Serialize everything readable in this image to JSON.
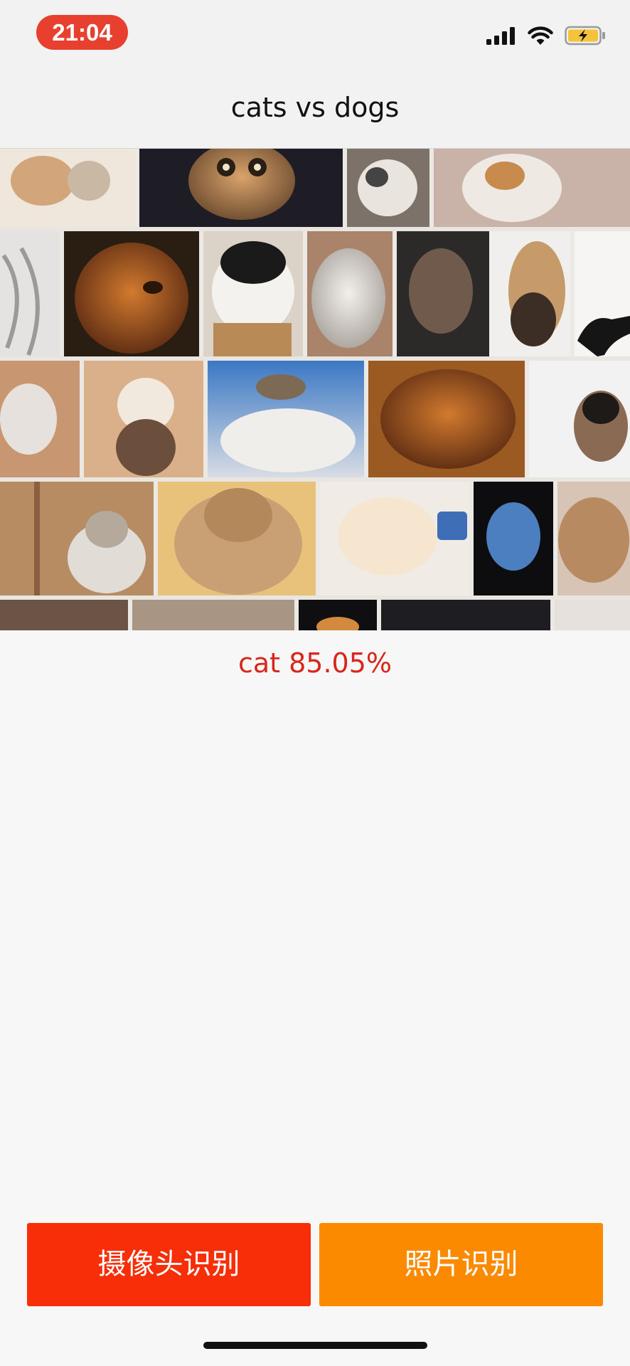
{
  "status_bar": {
    "time": "21:04",
    "icons": [
      "cellular-signal-icon",
      "wifi-icon",
      "battery-charging-icon"
    ],
    "time_pill_color": "#e8402e",
    "battery_color": "#f5c23c"
  },
  "nav": {
    "title": "cats vs dogs"
  },
  "image": {
    "description_icon": "cat-collage-photo"
  },
  "result": {
    "text": "cat 85.05%",
    "color": "#d8261a"
  },
  "buttons": {
    "camera_label": "摄像头识别",
    "camera_color": "#f72e07",
    "photo_label": "照片识别",
    "photo_color": "#fb8a00"
  }
}
